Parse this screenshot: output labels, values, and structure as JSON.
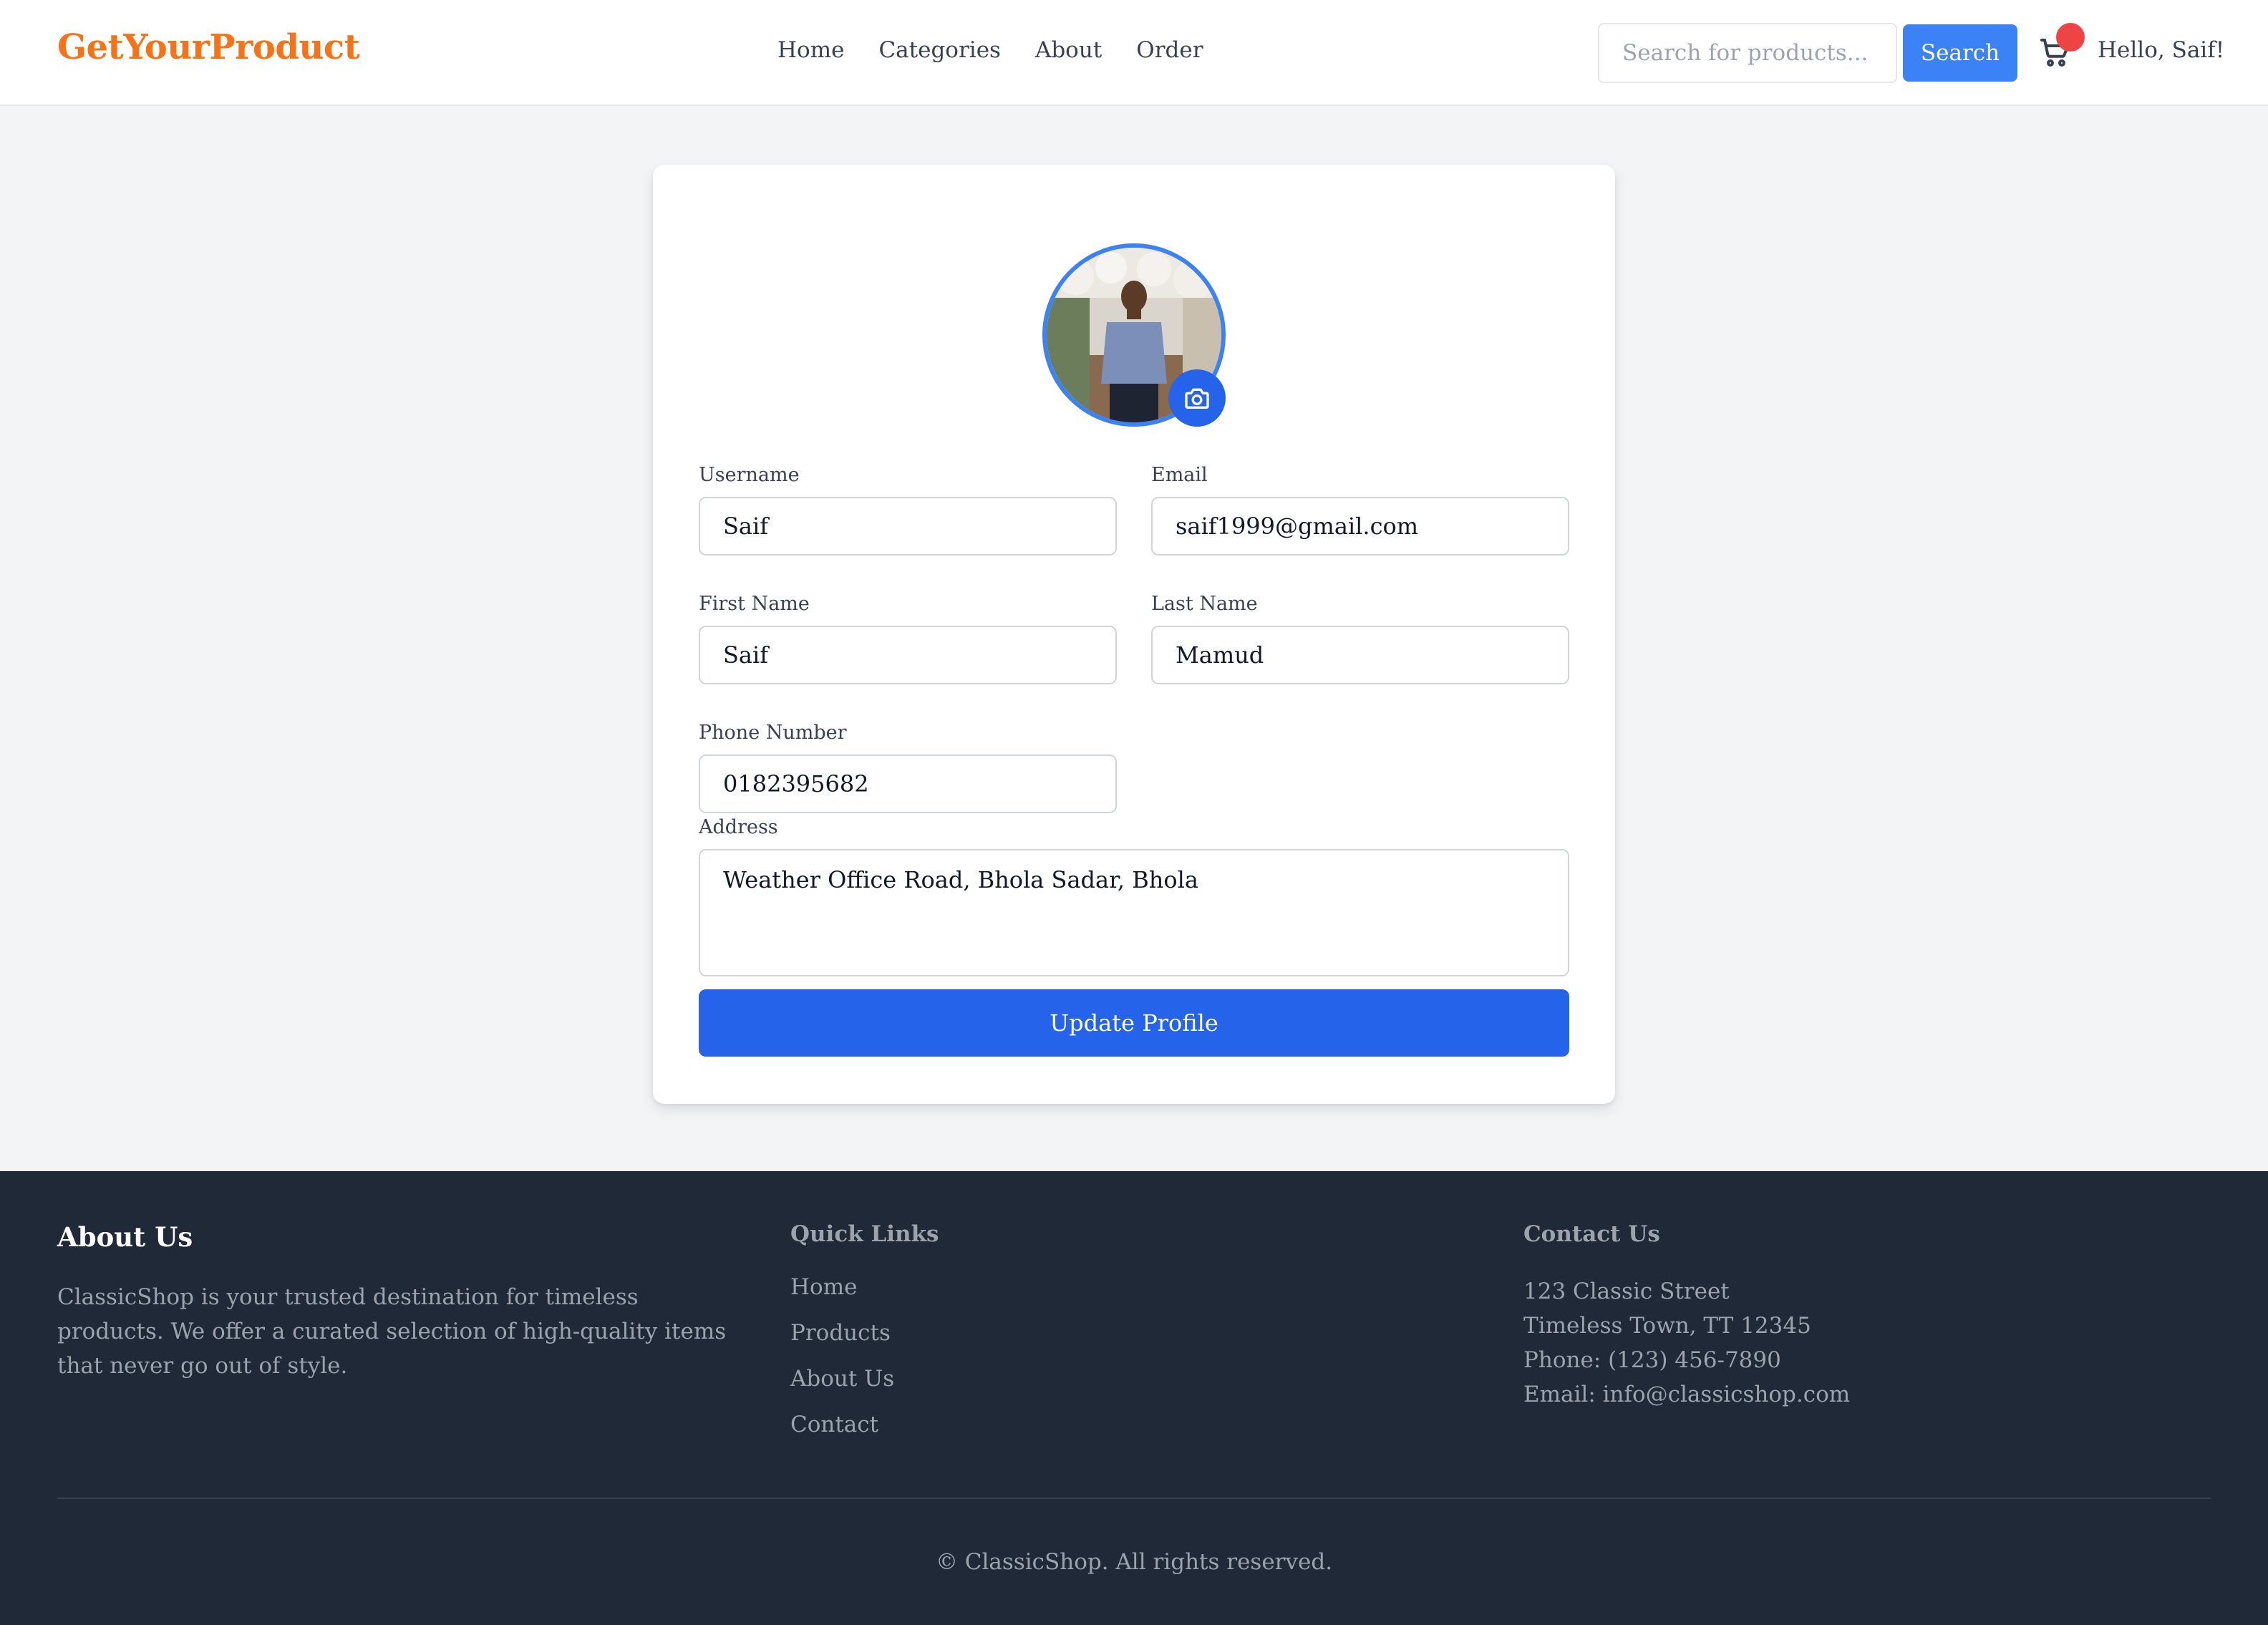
{
  "header": {
    "brand": "GetYourProduct",
    "nav": [
      "Home",
      "Categories",
      "About",
      "Order"
    ],
    "search_placeholder": "Search for products...",
    "search_label": "Search",
    "greeting": "Hello, Saif!"
  },
  "profile": {
    "username_label": "Username",
    "username_value": "Saif",
    "email_label": "Email",
    "email_value": "saif1999@gmail.com",
    "first_name_label": "First Name",
    "first_name_value": "Saif",
    "last_name_label": "Last Name",
    "last_name_value": "Mamud",
    "phone_label": "Phone Number",
    "phone_value": "0182395682",
    "address_label": "Address",
    "address_value": "Weather Office Road, Bhola Sadar, Bhola",
    "update_label": "Update Profile"
  },
  "footer": {
    "about_title": "About Us",
    "about_text": "ClassicShop is your trusted destination for timeless products. We offer a curated selection of high-quality items that never go out of style.",
    "links_title": "Quick Links",
    "links": [
      "Home",
      "Products",
      "About Us",
      "Contact"
    ],
    "contact_title": "Contact Us",
    "contact": [
      "123 Classic Street",
      "Timeless Town, TT 12345",
      "Phone: (123) 456-7890",
      "Email: info@classicshop.com"
    ],
    "copyright": "© ClassicShop. All rights reserved."
  },
  "colors": {
    "brand": "#f97316",
    "primary": "#2563eb",
    "search_button": "#3b82f6",
    "badge": "#ef4444",
    "footer_bg": "#1f2937"
  }
}
